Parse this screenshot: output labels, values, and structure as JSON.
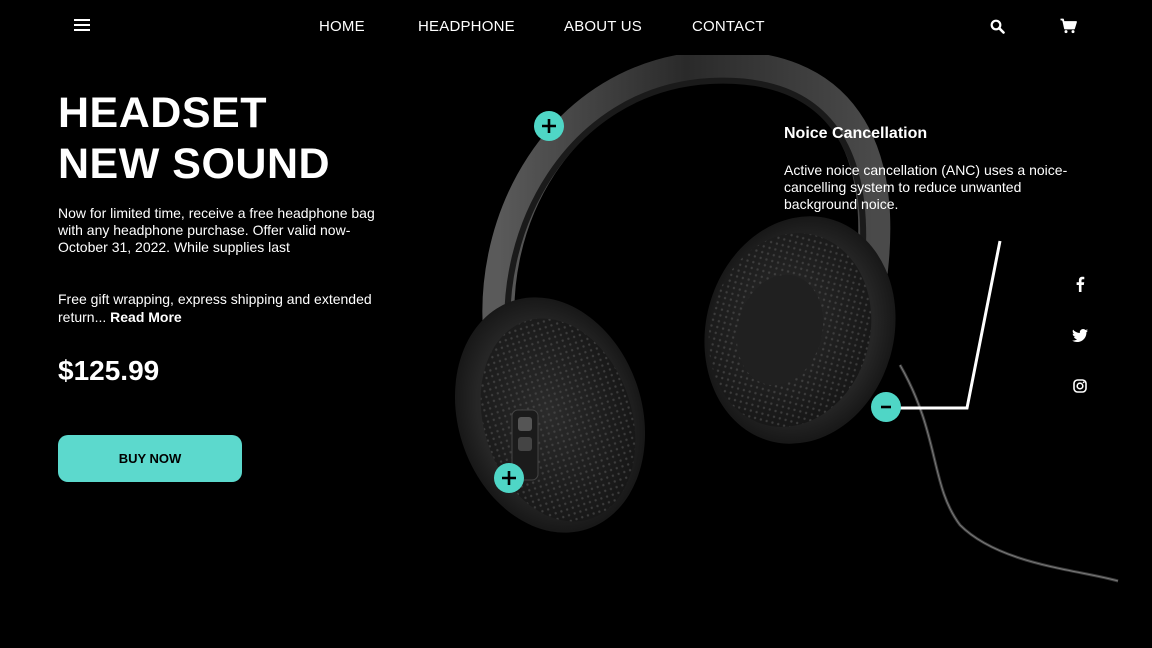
{
  "nav": {
    "links": [
      "HOME",
      "HEADPHONE",
      "ABOUT US",
      "CONTACT"
    ]
  },
  "icons": {
    "menu": "hamburger-menu-icon",
    "search": "search-icon",
    "cart": "cart-icon",
    "facebook": "facebook-icon",
    "twitter": "twitter-icon",
    "instagram": "instagram-icon"
  },
  "hero": {
    "title_line1": "HEADSET",
    "title_line2": "NEW SOUND",
    "promo_text": "Now for limited time, receive a free headphone bag with any headphone purchase. Offer valid now-October 31, 2022. While supplies last",
    "gift_text": "Free gift wrapping, express shipping and extended return...",
    "read_more": "Read More",
    "price": "$125.99",
    "buy_label": "BUY NOW"
  },
  "feature": {
    "title": "Noice Cancellation",
    "description": "Active noice cancellation (ANC) uses a noice-cancelling system to reduce unwanted background noice."
  },
  "hotspots": {
    "top": "+",
    "bottom": "+",
    "active": "-"
  },
  "colors": {
    "accent": "#5cd9cd",
    "background": "#000000",
    "text": "#ffffff"
  }
}
